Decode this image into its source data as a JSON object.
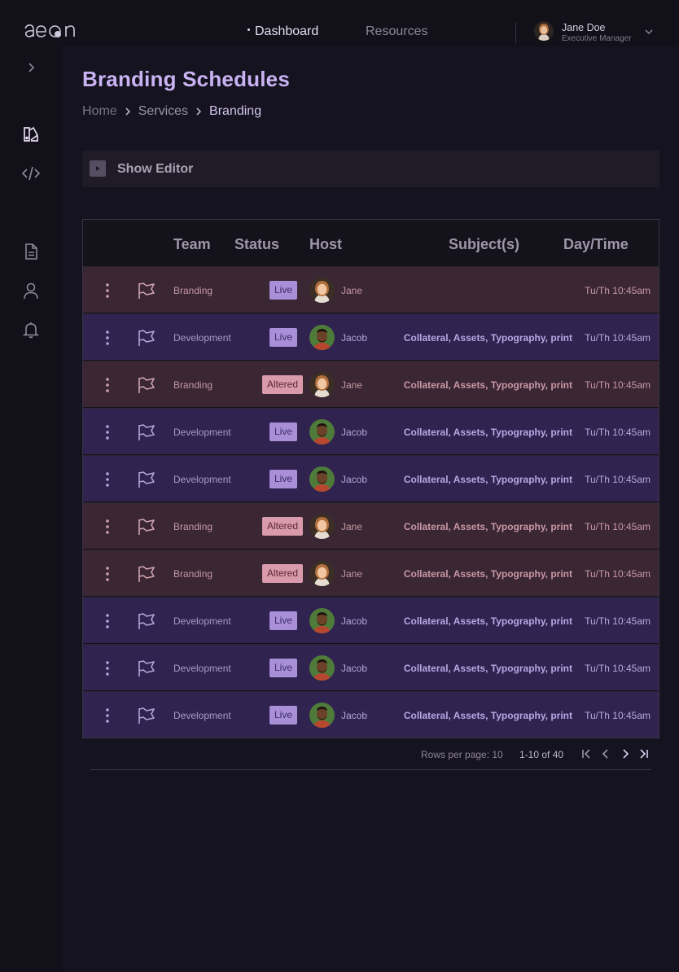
{
  "app": {
    "logo_text": "aeon"
  },
  "nav": {
    "items": [
      {
        "label": "Dashboard",
        "active": true
      },
      {
        "label": "Resources",
        "active": false
      }
    ]
  },
  "user": {
    "name": "Jane Doe",
    "role": "Executive Manager"
  },
  "sidebar": {
    "icons": [
      "chevron-right-icon",
      "palette-icon",
      "code-icon",
      "document-icon",
      "user-icon",
      "bell-icon"
    ]
  },
  "page": {
    "title": "Branding Schedules",
    "breadcrumb": [
      "Home",
      "Services",
      "Branding"
    ]
  },
  "editor": {
    "label": "Show Editor"
  },
  "table": {
    "headers": {
      "team": "Team",
      "status": "Status",
      "host": "Host",
      "subjects": "Subject(s)",
      "daytime": "Day/Time"
    },
    "rows": [
      {
        "team": "Branding",
        "status": "Live",
        "host": "Jane",
        "subjects": "",
        "daytime": "Tu/Th 10:45am",
        "kind": "brand",
        "avatar": "jane"
      },
      {
        "team": "Development",
        "status": "Live",
        "host": "Jacob",
        "subjects": "Collateral, Assets, Typography, print",
        "daytime": "Tu/Th 10:45am",
        "kind": "dev",
        "avatar": "jacob"
      },
      {
        "team": "Branding",
        "status": "Altered",
        "host": "Jane",
        "subjects": "Collateral, Assets, Typography, print",
        "daytime": "Tu/Th 10:45am",
        "kind": "brand",
        "avatar": "jane"
      },
      {
        "team": "Development",
        "status": "Live",
        "host": "Jacob",
        "subjects": "Collateral, Assets, Typography, print",
        "daytime": "Tu/Th 10:45am",
        "kind": "dev",
        "avatar": "jacob"
      },
      {
        "team": "Development",
        "status": "Live",
        "host": "Jacob",
        "subjects": "Collateral, Assets, Typography, print",
        "daytime": "Tu/Th 10:45am",
        "kind": "dev",
        "avatar": "jacob"
      },
      {
        "team": "Branding",
        "status": "Altered",
        "host": "Jane",
        "subjects": "Collateral, Assets, Typography, print",
        "daytime": "Tu/Th 10:45am",
        "kind": "brand",
        "avatar": "jane"
      },
      {
        "team": "Branding",
        "status": "Altered",
        "host": "Jane",
        "subjects": "Collateral, Assets, Typography, print",
        "daytime": "Tu/Th 10:45am",
        "kind": "brand",
        "avatar": "jane"
      },
      {
        "team": "Development",
        "status": "Live",
        "host": "Jacob",
        "subjects": "Collateral, Assets, Typography, print",
        "daytime": "Tu/Th 10:45am",
        "kind": "dev",
        "avatar": "jacob"
      },
      {
        "team": "Development",
        "status": "Live",
        "host": "Jacob",
        "subjects": "Collateral, Assets, Typography, print",
        "daytime": "Tu/Th 10:45am",
        "kind": "dev",
        "avatar": "jacob"
      },
      {
        "team": "Development",
        "status": "Live",
        "host": "Jacob",
        "subjects": "Collateral, Assets, Typography, print",
        "daytime": "Tu/Th 10:45am",
        "kind": "dev",
        "avatar": "jacob"
      }
    ]
  },
  "pagination": {
    "rows_per_page": "Rows per page: 10",
    "range": "1-10 of 40"
  },
  "colors": {
    "accent": "#c9b3f3",
    "brand_row": "#3b2633",
    "dev_row": "#30234f",
    "live_badge": "#a88fd8",
    "altered_badge": "#d99aac"
  }
}
